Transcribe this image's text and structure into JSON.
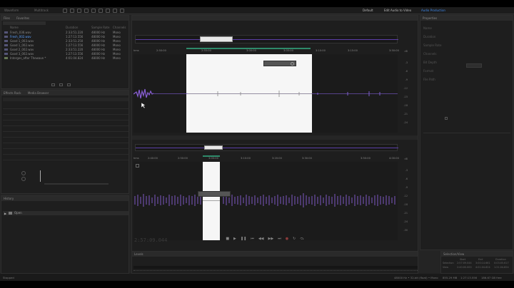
{
  "top": {
    "tabs": [
      "Waveform",
      "Multitrack"
    ],
    "workspaces": [
      {
        "label": "Default",
        "active": false
      },
      {
        "label": "Edit Audio to Video",
        "active": false
      },
      {
        "label": "Audio Production",
        "active": true
      }
    ]
  },
  "files": {
    "header": [
      "Files",
      "Favorites"
    ],
    "columns": {
      "name": "Name",
      "duration": "Duration",
      "rate": "Sample Rate",
      "channels": "Channels"
    },
    "rows": [
      {
        "name": "Fresh_036.wav",
        "duration": "2:33:51.220",
        "rate": "48000 Hz",
        "channels": "Mono"
      },
      {
        "name": "Fresh_002.wav",
        "duration": "1:27:13.556",
        "rate": "48000 Hz",
        "channels": "Mono",
        "selected": true
      },
      {
        "name": "Good 1_003.wav",
        "duration": "2:33:51.250",
        "rate": "48000 Hz",
        "channels": "Mono"
      },
      {
        "name": "Good 1_002.wav",
        "duration": "1:27:13.556",
        "rate": "48000 Hz",
        "channels": "Mono"
      },
      {
        "name": "Good 2_002.wav",
        "duration": "2:33:51.220",
        "rate": "48000 Hz",
        "channels": "Mono"
      },
      {
        "name": "Good 3_002.wav",
        "duration": "1:27:13.556",
        "rate": "48000 Hz",
        "channels": "Mono"
      },
      {
        "name": "Interges_after Thewave *",
        "duration": "4:01:04.824",
        "rate": "48000 Hz",
        "channels": "Mono"
      }
    ]
  },
  "effects": {
    "header": [
      "Effects Rack",
      "Media Browser"
    ]
  },
  "history": {
    "header": "History",
    "item": "Open"
  },
  "editor": {
    "ruler_top": [
      "hms",
      "2:50:00",
      "2:55:00",
      "3:00:00",
      "3:05:00",
      "3:10:00",
      "3:15:00",
      "3:20:00",
      "3:40:00",
      "3:45:00",
      "3:50:00"
    ],
    "ruler_bottom": [
      "hms",
      "2:40:00",
      "2:50:00",
      "3:00:00",
      "3:10:00",
      "3:20:00",
      "3:30:00",
      "3:40:00",
      "3:50:00",
      "4:00:00"
    ],
    "db_top": [
      "dB",
      "-3",
      "-6",
      "-9",
      "-12",
      "-15",
      "-18",
      "-21",
      "-24",
      "-27",
      "-30",
      "-18",
      "-9"
    ],
    "db_bottom": [
      "dB",
      "-3",
      "-6",
      "-9",
      "-12",
      "-18",
      "-21",
      "-24",
      "-30",
      "-18",
      "-9",
      "-3"
    ],
    "timecode": "2:57:09.044"
  },
  "properties": {
    "header": "Properties",
    "rows": [
      "Name",
      "Duration",
      "Sample Rate",
      "Channels",
      "Bit Depth",
      "Format",
      "File Path"
    ]
  },
  "levels": {
    "header": "Levels"
  },
  "selection": {
    "header": "Selection/View",
    "columns": [
      "Start",
      "End",
      "Duration"
    ],
    "rows": [
      {
        "label": "Selection",
        "start": "2:57:09.044",
        "end": "3:00:14.661",
        "dur": "0:03:05.617"
      },
      {
        "label": "View",
        "start": "2:40:00.000",
        "end": "4:01:04.824",
        "dur": "1:21:04.824"
      }
    ]
  },
  "status": {
    "left": "Stopped",
    "items": [
      "48000 Hz • 32-bit (float) • Mono",
      "855.29 MB",
      "1:27:13.556",
      "186.67 GB free"
    ]
  }
}
